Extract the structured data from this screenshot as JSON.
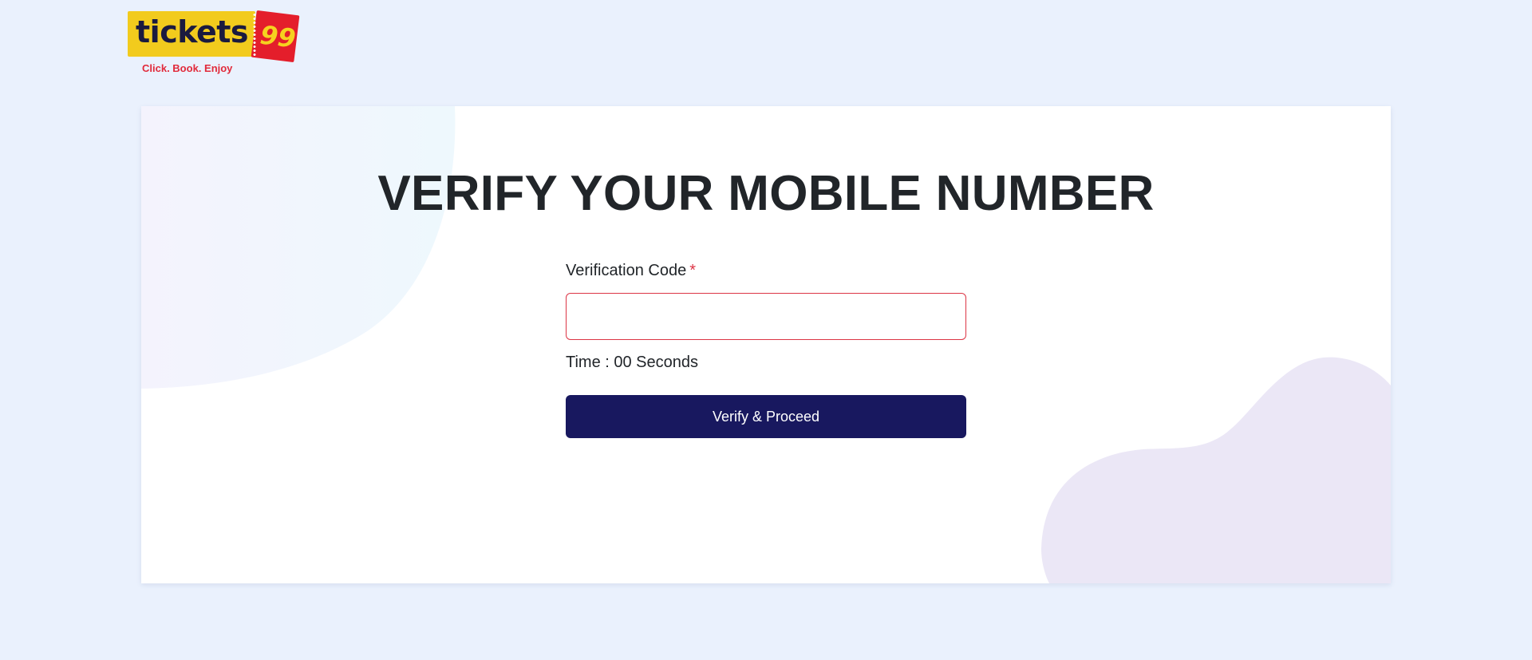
{
  "logo": {
    "word": "tickets",
    "number": "99",
    "tagline": "Click. Book. Enjoy"
  },
  "page": {
    "title": "VERIFY YOUR MOBILE NUMBER"
  },
  "form": {
    "code_label": "Verification Code",
    "required_mark": "*",
    "code_value": "",
    "timer_text": "Time : 00 Seconds",
    "submit_label": "Verify & Proceed"
  },
  "colors": {
    "page_background": "#eaf1fd",
    "button": "#18185f",
    "required": "#dc3545",
    "logo_yellow": "#f2cb1d",
    "logo_red": "#e41e2b"
  }
}
